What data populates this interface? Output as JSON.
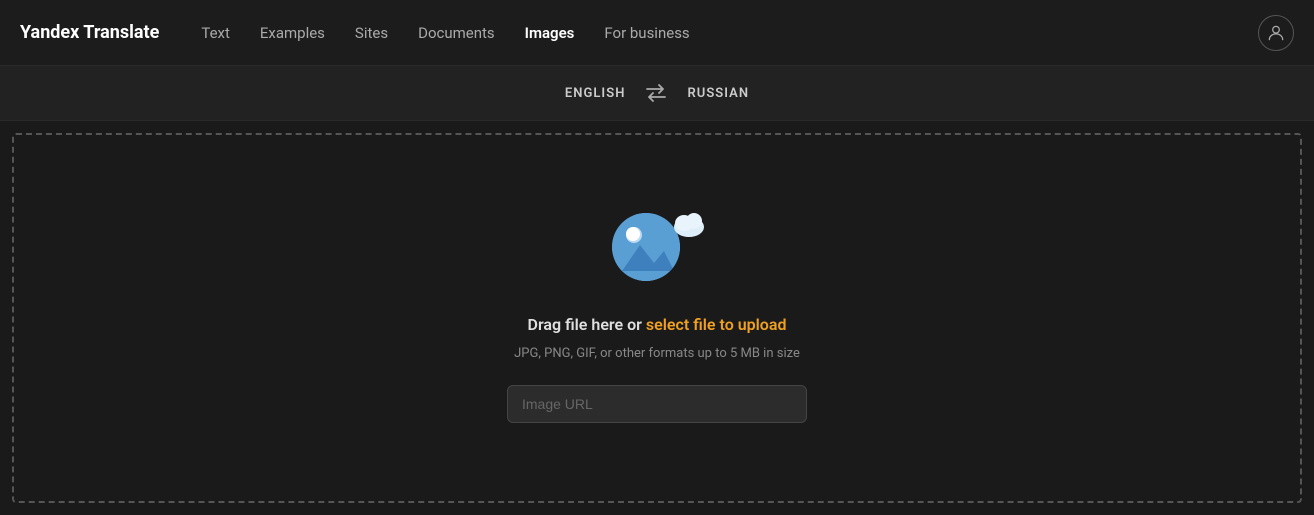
{
  "brand": "Yandex Translate",
  "nav": {
    "items": [
      {
        "label": "Text",
        "active": false
      },
      {
        "label": "Examples",
        "active": false
      },
      {
        "label": "Sites",
        "active": false
      },
      {
        "label": "Documents",
        "active": false
      },
      {
        "label": "Images",
        "active": true
      },
      {
        "label": "For business",
        "active": false
      }
    ]
  },
  "lang_bar": {
    "source": "ENGLISH",
    "swap_icon": "⇄",
    "target": "RUSSIAN"
  },
  "drop_zone": {
    "drag_text": "Drag file here or ",
    "link_text": "select file to upload",
    "subtext": "JPG, PNG, GIF, or other formats up to 5 MB in size",
    "url_placeholder": "Image URL"
  },
  "user_icon": "👤"
}
